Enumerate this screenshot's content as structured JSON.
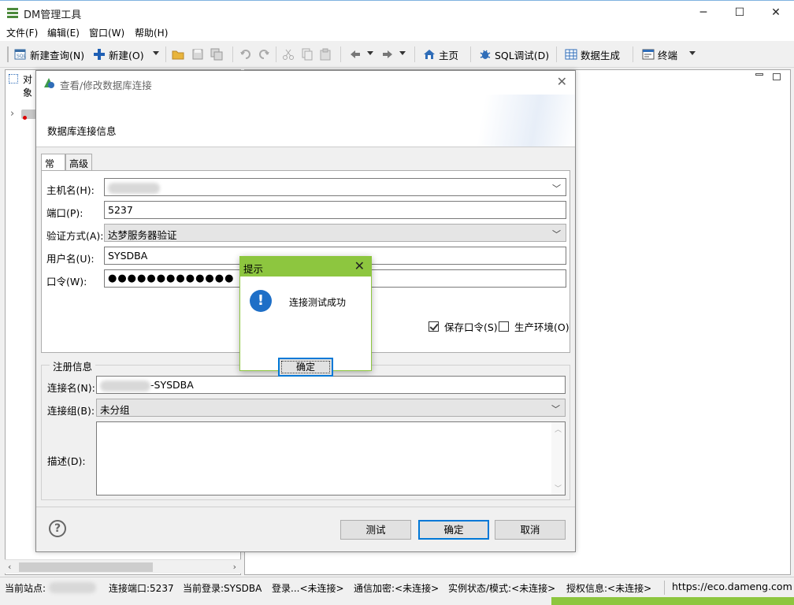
{
  "window": {
    "title": "DM管理工具",
    "minimize": "─",
    "maximize": "☐",
    "close": "✕"
  },
  "menu": [
    "文件(F)",
    "编辑(E)",
    "窗口(W)",
    "帮助(H)"
  ],
  "toolbar": {
    "new_query": "新建查询(N)",
    "new": "新建(O)",
    "home": "主页",
    "sql_debug": "SQL调试(D)",
    "data_gen": "数据生成",
    "terminal": "终端"
  },
  "left_panel": {
    "tab_label": "对象"
  },
  "dialog": {
    "title": "查看/修改数据库连接",
    "close": "✕",
    "banner_heading": "数据库连接信息",
    "tabs": [
      "常规",
      "高级"
    ],
    "host_label": "主机名(H):",
    "host_value": "",
    "port_label": "端口(P):",
    "port_value": "5237",
    "auth_label": "验证方式(A):",
    "auth_value": "达梦服务器验证",
    "user_label": "用户名(U):",
    "user_value": "SYSDBA",
    "password_label": "口令(W):",
    "password_value": "●●●●●●●●●●●●●",
    "save_password_label": "保存口令(S)",
    "save_password_checked": true,
    "production_label": "生产环境(O)",
    "production_checked": false,
    "register_group_title": "注册信息",
    "conn_name_label": "连接名(N):",
    "conn_name_suffix": "-SYSDBA",
    "conn_group_label": "连接组(B):",
    "conn_group_value": "未分组",
    "desc_label": "描述(D):",
    "test_button": "测试",
    "ok_button": "确定",
    "cancel_button": "取消",
    "help": "?"
  },
  "message_box": {
    "title": "提示",
    "close": "✕",
    "message": "连接测试成功",
    "ok_button": "确定",
    "icon": "!"
  },
  "status": {
    "site_label": "当前站点:",
    "port": "连接端口:5237",
    "login": "当前登录:SYSDBA",
    "logon": "登录...<未连接>",
    "encrypt": "通信加密:<未连接>",
    "instance": "实例状态/模式:<未连接>",
    "license": "授权信息:<未连接>",
    "url": "https://eco.dameng.com"
  },
  "colors": {
    "accent": "#0078d7",
    "msgbox_title": "#8dc63f",
    "info_icon": "#1e6fc7"
  }
}
